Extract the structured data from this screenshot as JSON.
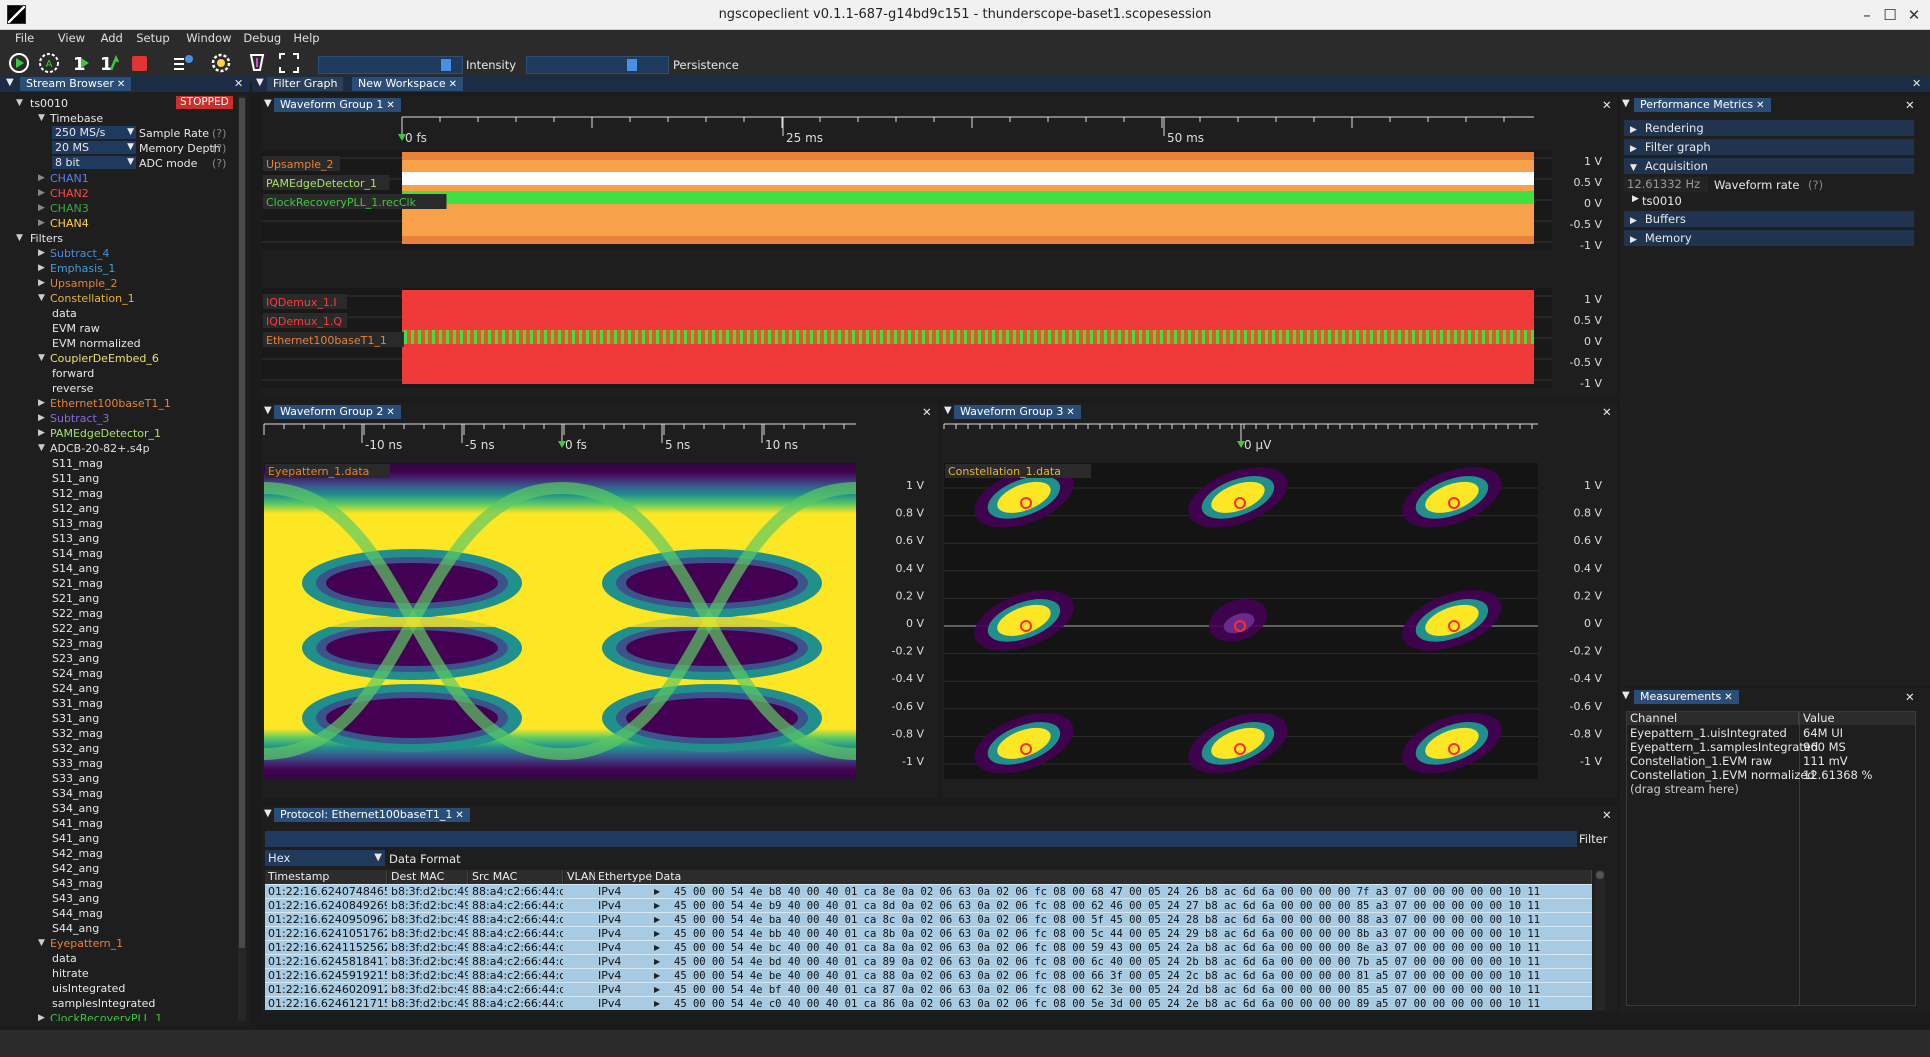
{
  "window": {
    "title": "ngscopeclient v0.1.1-687-g14bd9c151  - thunderscope-baset1.scopesession",
    "minimize": "–",
    "maximize": "☐",
    "close": "✕"
  },
  "menu": [
    "File",
    "View",
    "Add",
    "Setup",
    "Window",
    "Debug",
    "Help"
  ],
  "toolbar": {
    "intensity_label": "Intensity",
    "intensity_level": 0.9,
    "persistence_label": "Persistence",
    "persistence_level": 0.75
  },
  "tabs": {
    "stream_browser": "Stream Browser",
    "filter_graph": "Filter Graph",
    "new_workspace": "New Workspace",
    "close": "✕"
  },
  "stream_browser": {
    "instrument": "ts0010",
    "state": "STOPPED",
    "timebase": "Timebase",
    "settings": [
      {
        "value": "250 MS/s",
        "label": "Sample Rate",
        "help": "(?)"
      },
      {
        "value": "20 MS",
        "label": "Memory Depth",
        "help": "(?)"
      },
      {
        "value": "8 bit",
        "label": "ADC mode",
        "help": "(?)"
      }
    ],
    "channels": [
      {
        "name": "CHAN1",
        "color": "#5a7bff"
      },
      {
        "name": "CHAN2",
        "color": "#ff4a4a"
      },
      {
        "name": "CHAN3",
        "color": "#3fa83f"
      },
      {
        "name": "CHAN4",
        "color": "#ffd23f"
      }
    ],
    "filters_label": "Filters",
    "filters": [
      {
        "name": "Subtract_4",
        "color": "#4a8ce0",
        "open": false
      },
      {
        "name": "Emphasis_1",
        "color": "#3aa0d8",
        "open": false
      },
      {
        "name": "Upsample_2",
        "color": "#e8813a",
        "open": false
      },
      {
        "name": "Constellation_1",
        "color": "#e8b33a",
        "open": true,
        "children": [
          "data",
          "EVM raw",
          "EVM normalized"
        ]
      },
      {
        "name": "CouplerDeEmbed_6",
        "color": "#e8e070",
        "open": true,
        "children": [
          "forward",
          "reverse"
        ]
      },
      {
        "name": "Ethernet100baseT1_1",
        "color": "#e8813a",
        "open": false
      },
      {
        "name": "Subtract_3",
        "color": "#8a6ad8",
        "open": false
      },
      {
        "name": "PAMEdgeDetector_1",
        "color": "#a8e070",
        "open": false
      },
      {
        "name": "ADCB-20-82+.s4p",
        "color": "#e0e0e0",
        "open": true,
        "children": [
          "S11_mag",
          "S11_ang",
          "S12_mag",
          "S12_ang",
          "S13_mag",
          "S13_ang",
          "S14_mag",
          "S14_ang",
          "S21_mag",
          "S21_ang",
          "S22_mag",
          "S22_ang",
          "S23_mag",
          "S23_ang",
          "S24_mag",
          "S24_ang",
          "S31_mag",
          "S31_ang",
          "S32_mag",
          "S32_ang",
          "S33_mag",
          "S33_ang",
          "S34_mag",
          "S34_ang",
          "S41_mag",
          "S41_ang",
          "S42_mag",
          "S42_ang",
          "S43_mag",
          "S43_ang",
          "S44_mag",
          "S44_ang"
        ]
      },
      {
        "name": "Eyepattern_1",
        "color": "#e8813a",
        "open": true,
        "children": [
          "data",
          "hitrate",
          "uisIntegrated",
          "samplesIntegrated"
        ]
      },
      {
        "name": "ClockRecoveryPLL_1",
        "color": "#3fc83f",
        "open": false
      }
    ]
  },
  "group1": {
    "title": "Waveform Group 1",
    "time_ticks": [
      "0 fs",
      "25 ms",
      "50 ms"
    ],
    "area1_traces": [
      {
        "name": "Upsample_2",
        "color": "#e8813a"
      },
      {
        "name": "PAMEdgeDetector_1",
        "color": "#a8e070"
      },
      {
        "name": "ClockRecoveryPLL_1.recClk",
        "color": "#3fc83f"
      }
    ],
    "area2_traces": [
      {
        "name": "IQDemux_1.I",
        "color": "#ff3a3a"
      },
      {
        "name": "IQDemux_1.Q",
        "color": "#ff3a3a"
      },
      {
        "name": "Ethernet100baseT1_1",
        "color": "#e8813a"
      }
    ],
    "y_ticks": [
      "1 V",
      "0.5 V",
      "0 V",
      "-0.5 V",
      "-1 V"
    ]
  },
  "group2": {
    "title": "Waveform Group 2",
    "time_ticks": [
      "-10 ns",
      "-5 ns",
      "0 fs",
      "5 ns",
      "10 ns"
    ],
    "trace": "Eyepattern_1.data",
    "y_ticks": [
      "1 V",
      "0.8 V",
      "0.6 V",
      "0.4 V",
      "0.2 V",
      "0 V",
      "-0.2 V",
      "-0.4 V",
      "-0.6 V",
      "-0.8 V",
      "-1 V"
    ]
  },
  "group3": {
    "title": "Waveform Group 3",
    "time_tick": "0 µV",
    "trace": "Constellation_1.data",
    "y_ticks": [
      "1 V",
      "0.8 V",
      "0.6 V",
      "0.4 V",
      "0.2 V",
      "0 V",
      "-0.2 V",
      "-0.4 V",
      "-0.6 V",
      "-0.8 V",
      "-1 V"
    ]
  },
  "perf": {
    "title": "Performance Metrics",
    "sections": [
      "Rendering",
      "Filter graph",
      "Acquisition",
      "Buffers",
      "Memory"
    ],
    "waveform_rate_value": "12.61332 Hz",
    "waveform_rate_label": "Waveform rate",
    "help": "(?)",
    "instrument": "ts0010"
  },
  "measurements": {
    "title": "Measurements",
    "columns": [
      "Channel",
      "Value"
    ],
    "rows": [
      [
        "Eyepattern_1.uisIntegrated",
        "64M UI"
      ],
      [
        "Eyepattern_1.samplesIntegrated",
        "960 MS"
      ],
      [
        "Constellation_1.EVM raw",
        "111 mV"
      ],
      [
        "Constellation_1.EVM normalized",
        "12.61368 %"
      ]
    ],
    "drag_hint": "(drag stream here)"
  },
  "protocol": {
    "title": "Protocol: Ethernet100baseT1_1",
    "filter_label": "Filter",
    "format_value": "Hex",
    "format_label": "Data Format",
    "columns": [
      "Timestamp",
      "Dest MAC",
      "Src MAC",
      "VLAN",
      "Ethertype",
      "Data"
    ],
    "rows": [
      [
        "01:22:16.6240748465",
        "b8:3f:d2:bc:49:da",
        "88:a4:c2:66:44:dd",
        "",
        "IPv4",
        "45 00 00 54 4e b8 40 00 40 01 ca 8e 0a 02 06 63 0a 02 06 fc 08 00 68 47 00 05 24 26 b8 ac 6d 6a 00 00 00 00 7f a3 07 00 00 00 00 00 10 11"
      ],
      [
        "01:22:16.6240849269",
        "b8:3f:d2:bc:49:da",
        "88:a4:c2:66:44:dd",
        "",
        "IPv4",
        "45 00 00 54 4e b9 40 00 40 01 ca 8d 0a 02 06 63 0a 02 06 fc 08 00 62 46 00 05 24 27 b8 ac 6d 6a 00 00 00 00 85 a3 07 00 00 00 00 00 10 11"
      ],
      [
        "01:22:16.6240950962",
        "b8:3f:d2:bc:49:da",
        "88:a4:c2:66:44:dd",
        "",
        "IPv4",
        "45 00 00 54 4e ba 40 00 40 01 ca 8c 0a 02 06 63 0a 02 06 fc 08 00 5f 45 00 05 24 28 b8 ac 6d 6a 00 00 00 00 88 a3 07 00 00 00 00 00 10 11"
      ],
      [
        "01:22:16.6241051762",
        "b8:3f:d2:bc:49:da",
        "88:a4:c2:66:44:dd",
        "",
        "IPv4",
        "45 00 00 54 4e bb 40 00 40 01 ca 8b 0a 02 06 63 0a 02 06 fc 08 00 5c 44 00 05 24 29 b8 ac 6d 6a 00 00 00 00 8b a3 07 00 00 00 00 00 10 11"
      ],
      [
        "01:22:16.6241152562",
        "b8:3f:d2:bc:49:da",
        "88:a4:c2:66:44:dd",
        "",
        "IPv4",
        "45 00 00 54 4e bc 40 00 40 01 ca 8a 0a 02 06 63 0a 02 06 fc 08 00 59 43 00 05 24 2a b8 ac 6d 6a 00 00 00 00 8e a3 07 00 00 00 00 00 10 11"
      ],
      [
        "01:22:16.6245818417",
        "b8:3f:d2:bc:49:da",
        "88:a4:c2:66:44:dd",
        "",
        "IPv4",
        "45 00 00 54 4e bd 40 00 40 01 ca 89 0a 02 06 63 0a 02 06 fc 08 00 6c 40 00 05 24 2b b8 ac 6d 6a 00 00 00 00 7b a5 07 00 00 00 00 00 10 11"
      ],
      [
        "01:22:16.6245919215",
        "b8:3f:d2:bc:49:da",
        "88:a4:c2:66:44:dd",
        "",
        "IPv4",
        "45 00 00 54 4e be 40 00 40 01 ca 88 0a 02 06 63 0a 02 06 fc 08 00 66 3f 00 05 24 2c b8 ac 6d 6a 00 00 00 00 81 a5 07 00 00 00 00 00 10 11"
      ],
      [
        "01:22:16.6246020912",
        "b8:3f:d2:bc:49:da",
        "88:a4:c2:66:44:dd",
        "",
        "IPv4",
        "45 00 00 54 4e bf 40 00 40 01 ca 87 0a 02 06 63 0a 02 06 fc 08 00 62 3e 00 05 24 2d b8 ac 6d 6a 00 00 00 00 85 a5 07 00 00 00 00 00 10 11"
      ],
      [
        "01:22:16.6246121715",
        "b8:3f:d2:bc:49:da",
        "88:a4:c2:66:44:dd",
        "",
        "IPv4",
        "45 00 00 54 4e c0 40 00 40 01 ca 86 0a 02 06 63 0a 02 06 fc 08 00 5e 3d 00 05 24 2e b8 ac 6d 6a 00 00 00 00 89 a5 07 00 00 00 00 00 10 11"
      ]
    ]
  }
}
